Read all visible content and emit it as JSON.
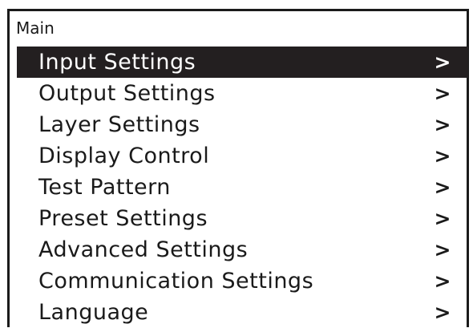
{
  "screen": {
    "title": "Main"
  },
  "menu": {
    "selected_index": 0,
    "items": [
      {
        "label": "Input Settings",
        "arrow": ">"
      },
      {
        "label": "Output Settings",
        "arrow": ">"
      },
      {
        "label": "Layer Settings",
        "arrow": ">"
      },
      {
        "label": "Display Control",
        "arrow": ">"
      },
      {
        "label": "Test Pattern",
        "arrow": ">"
      },
      {
        "label": "Preset Settings",
        "arrow": ">"
      },
      {
        "label": "Advanced Settings",
        "arrow": ">"
      },
      {
        "label": "Communication Settings",
        "arrow": ">"
      },
      {
        "label": "Language",
        "arrow": ">"
      }
    ]
  },
  "colors": {
    "highlight_bg": "#231f20",
    "highlight_fg": "#ffffff",
    "text": "#1a1a1a",
    "background": "#ffffff"
  }
}
